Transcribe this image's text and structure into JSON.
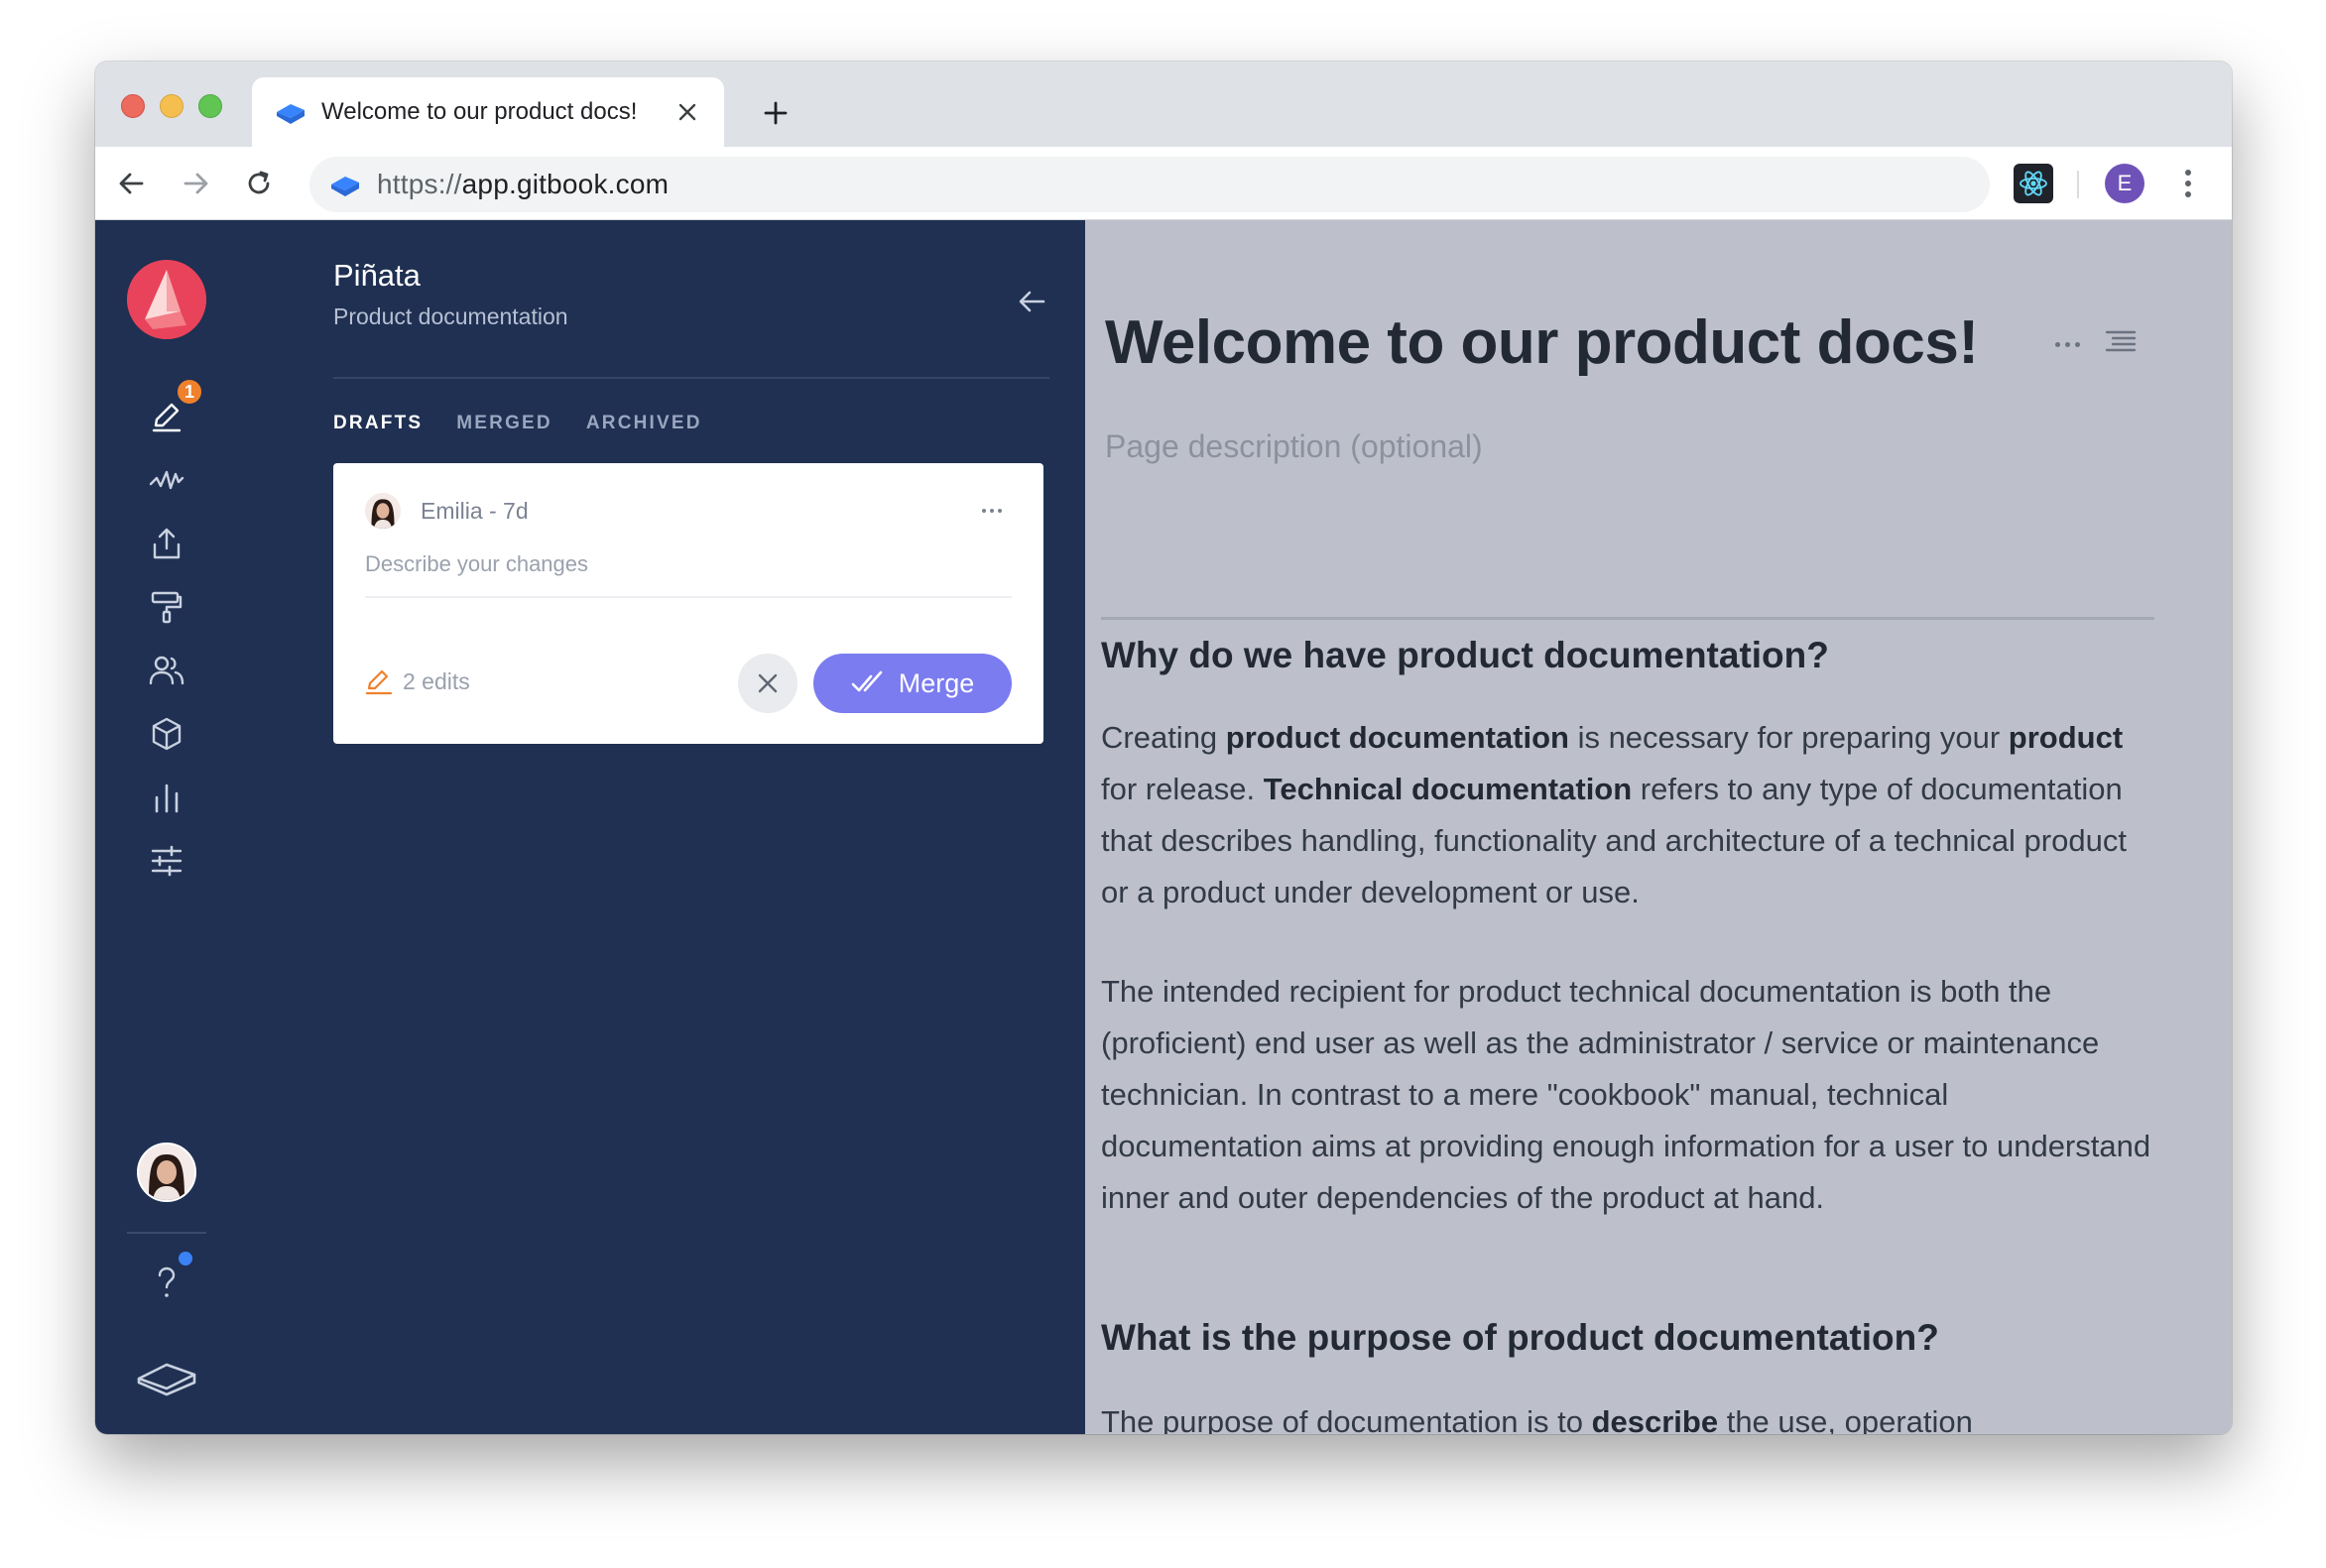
{
  "browser": {
    "tab_title": "Welcome to our product docs!",
    "url_scheme": "https://",
    "url_host": "app.gitbook.com",
    "profile_initial": "E"
  },
  "sidebar": {
    "drafts_badge": "1",
    "icons": [
      "edit-icon",
      "activity-icon",
      "share-icon",
      "paint-roller-icon",
      "users-icon",
      "package-icon",
      "bar-chart-icon",
      "sliders-icon"
    ]
  },
  "space": {
    "title": "Piñata",
    "subtitle": "Product documentation"
  },
  "panel": {
    "tabs": [
      {
        "label": "DRAFTS",
        "active": true
      },
      {
        "label": "MERGED",
        "active": false
      },
      {
        "label": "ARCHIVED",
        "active": false
      }
    ],
    "draft": {
      "author": "Emilia - 7d",
      "description_placeholder": "Describe your changes",
      "edits": "2 edits",
      "merge_label": "Merge"
    }
  },
  "doc": {
    "title": "Welcome to our product docs!",
    "description_placeholder": "Page description (optional)",
    "heading1": "Why do we have product documentation?",
    "p1": {
      "a": "Creating ",
      "b": "product documentation",
      "c": " is necessary for preparing your ",
      "d": "product",
      "e": " for release. ",
      "f": "Technical documentation",
      "g": " refers to any type of documentation that describes handling, functionality and architecture of a technical product or a product under development or use."
    },
    "p2": "The intended recipient for product technical documentation is both the (proficient) end user as well as the administrator / service or maintenance technician. In contrast to a mere \"cookbook\" manual, technical documentation aims at providing enough information for a user to understand inner and outer dependencies of the product at hand.",
    "heading2": "What is the purpose of product documentation?",
    "p3": {
      "a": "The purpose of documentation is to ",
      "b": "describe",
      "c": " the use, operation"
    }
  }
}
